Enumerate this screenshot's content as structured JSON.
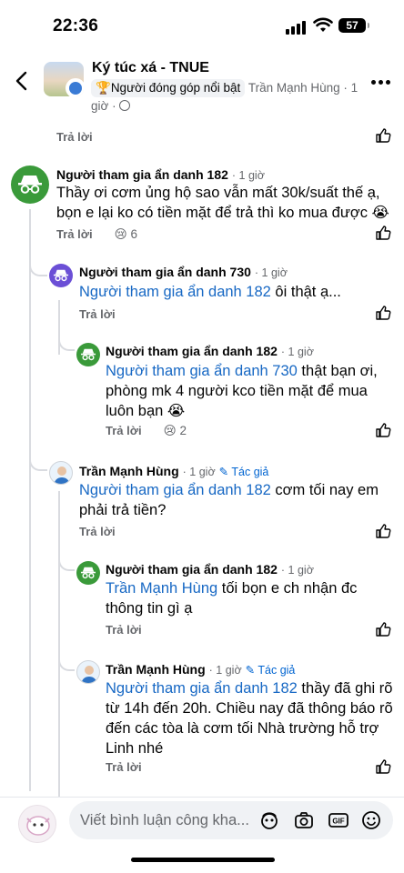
{
  "status_bar": {
    "time": "22:36",
    "battery": "57"
  },
  "header": {
    "title": "Ký túc xá - TNUE",
    "badge": "Người đóng góp nổi bật",
    "author": "Trần Mạnh Hùng",
    "time_prefix": "· 1",
    "time_suffix": "giờ ·"
  },
  "top_reply": {
    "reply_label": "Trả lời"
  },
  "comments": [
    {
      "name": "Người tham gia ẩn danh 182",
      "time": "· 1 giờ",
      "text": "Thầy ơi cơm ủng hộ sao vẫn mất 30k/suất thế ạ, bọn e lại ko có tiền mặt để trả thì ko mua được 😭",
      "reply_label": "Trả lời",
      "reaction": "😢",
      "reaction_count": "6"
    },
    {
      "name": "Người tham gia ẩn danh 730",
      "time": "· 1 giờ",
      "mention": "Người tham gia ẩn danh 182",
      "text": " ôi thật ạ...",
      "reply_label": "Trả lời"
    },
    {
      "name": "Người tham gia ẩn danh 182",
      "time": "· 1 giờ",
      "mention": "Người tham gia ẩn danh 730",
      "text": " thật bạn ơi, phòng mk 4 người kco tiền mặt để mua luôn bạn 😭",
      "reply_label": "Trả lời",
      "reaction": "😢",
      "reaction_count": "2"
    },
    {
      "name": "Trần Mạnh Hùng",
      "time": "· 1 giờ",
      "author_badge": "✎ Tác giả",
      "mention": "Người tham gia ẩn danh 182",
      "text": " cơm tối nay em phải trả tiền?",
      "reply_label": "Trả lời"
    },
    {
      "name": "Người tham gia ẩn danh 182",
      "time": "· 1 giờ",
      "mention": "Trần Mạnh Hùng",
      "text": " tối bọn e ch nhận đc thông tin gì ạ",
      "reply_label": "Trả lời"
    },
    {
      "name": "Trần Mạnh Hùng",
      "time": "· 1 giờ",
      "author_badge": "✎ Tác giả",
      "mention": "Người tham gia ẩn danh 182",
      "text": " thầy đã ghi rõ từ 14h đến 20h. Chiều nay đã thông báo rõ đến các tòa là cơm tối Nhà trường hỗ trợ Linh nhé",
      "reply_label": "Trả lời"
    }
  ],
  "composer": {
    "placeholder": "Viết bình luận công kha...",
    "icons": [
      "avatar-sticker-icon",
      "camera-icon",
      "gif-icon",
      "emoji-icon"
    ]
  },
  "colors": {
    "mention": "#1768c4",
    "anon_green": "#3a9a3a",
    "anon_purple": "#6b4fd6"
  }
}
